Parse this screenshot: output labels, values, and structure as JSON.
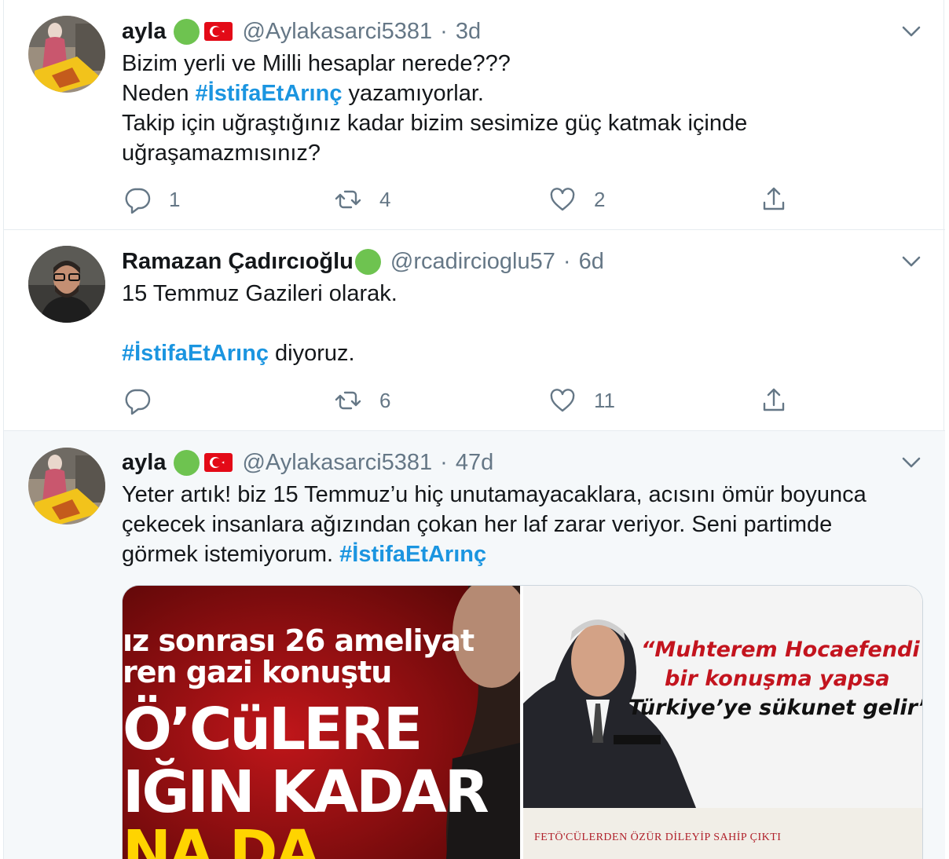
{
  "tweets": [
    {
      "name": "ayla",
      "handle": "@Aylakasarci5381",
      "sep": "·",
      "time": "3d",
      "lines": [
        [
          {
            "t": "Bizim yerli ve Milli hesaplar nerede???"
          }
        ],
        [
          {
            "t": "Neden "
          },
          {
            "t": "#İstifaEtArınç",
            "tag": true
          },
          {
            "t": " yazamıyorlar."
          }
        ],
        [
          {
            "t": "Takip için uğraştığınız kadar bizim sesimize güç katmak içinde"
          }
        ],
        [
          {
            "t": "uğraşamazmısınız?"
          }
        ]
      ],
      "counts": {
        "reply": "1",
        "retweet": "4",
        "like": "2"
      }
    },
    {
      "name": "Ramazan Çadırcıoğlu",
      "handle": "@rcadircioglu57",
      "sep": "·",
      "time": "6d",
      "lines": [
        [
          {
            "t": "15 Temmuz Gazileri olarak."
          }
        ],
        [],
        [
          {
            "t": "#İstifaEtArınç",
            "tag": true
          },
          {
            "t": " diyoruz."
          }
        ]
      ],
      "counts": {
        "reply": "",
        "retweet": "6",
        "like": "11"
      }
    },
    {
      "name": "ayla",
      "handle": "@Aylakasarci5381",
      "sep": "·",
      "time": "47d",
      "lines": [
        [
          {
            "t": "Yeter artık! biz 15 Temmuz’u hiç unutamayacaklara, acısını ömür boyunca"
          }
        ],
        [
          {
            "t": "çekecek insanlara ağızından çokan her laf zarar veriyor. Seni partimde"
          }
        ],
        [
          {
            "t": "görmek istemiyorum. "
          },
          {
            "t": "#İstifaEtArınç",
            "tag": true
          }
        ]
      ]
    }
  ],
  "media": {
    "left_lines": [
      "ız sonrası 26 ameliyat",
      "ren gazi konuştu",
      "Ö’CüLERE",
      "IĞIN KADAR",
      "NA DA"
    ],
    "right_quote": [
      "“Muhterem Hocaefendi",
      "bir konuşma yapsa",
      "Türkiye’ye sükunet gelir”"
    ],
    "right_caption": "FETÖ'CÜLERDEN ÖZÜR DİLEYİP SAHİP ÇIKTI"
  },
  "colors": {
    "hashtag": "#1b95e0",
    "muted": "#657786",
    "status_dot": "#6ec350",
    "flag": "#e30a17",
    "selected_row_bg": "#f5f8fa"
  },
  "icons": {
    "reply": "reply-icon",
    "retweet": "retweet-icon",
    "like": "heart-icon",
    "share": "share-icon",
    "caret": "chevron-down-icon",
    "status": "green-circle-emoji",
    "flag": "turkey-flag-emoji"
  }
}
